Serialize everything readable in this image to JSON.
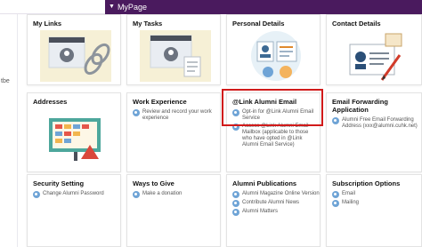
{
  "header": {
    "tab_label": "MyPage",
    "tab_icon": "chevron-down-icon"
  },
  "left_rail": {
    "text1": "",
    "text2": "tbe"
  },
  "tiles": {
    "my_links": {
      "title": "My Links"
    },
    "my_tasks": {
      "title": "My Tasks"
    },
    "personal_details": {
      "title": "Personal Details"
    },
    "contact_details": {
      "title": "Contact Details"
    },
    "addresses": {
      "title": "Addresses"
    },
    "work_experience": {
      "title": "Work Experience",
      "items": [
        "Review and record your work experience"
      ]
    },
    "link_alumni_email": {
      "title": "@Link Alumni Email",
      "items": [
        "Opt-in for @Link Alumni Email Service",
        "Access @Link Alumni Email Mailbox (applicable to those who have opted in @Link Alumni Email Service)"
      ]
    },
    "email_forwarding": {
      "title": "Email Forwarding Application",
      "items": [
        "Alumni Free Email Forwarding Address (xxx@alumni.cuhk.net)"
      ]
    },
    "security_setting": {
      "title": "Security Setting",
      "items": [
        "Change Alumni Password"
      ]
    },
    "ways_to_give": {
      "title": "Ways to Give",
      "items": [
        "Make a donation"
      ]
    },
    "alumni_publications": {
      "title": "Alumni Publications",
      "items": [
        "Alumni Magazine Online Version",
        "Contribute Alumni News",
        "Alumni Matters"
      ]
    },
    "subscription_options": {
      "title": "Subscription Options",
      "items": [
        "Email",
        "Mailing"
      ]
    }
  },
  "colors": {
    "header_purple": "#4a1a5e",
    "highlight_red": "#d11a1a",
    "link_bullet": "#6fa4d6"
  }
}
